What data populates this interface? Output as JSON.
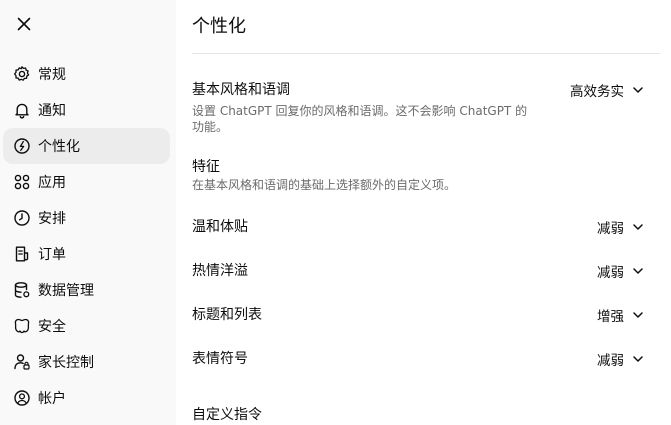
{
  "sidebar": {
    "close_icon": "close-icon",
    "items": [
      {
        "label": "常规",
        "icon": "gear-icon"
      },
      {
        "label": "通知",
        "icon": "bell-icon"
      },
      {
        "label": "个性化",
        "icon": "personalization-icon",
        "active": true
      },
      {
        "label": "应用",
        "icon": "apps-grid-icon"
      },
      {
        "label": "安排",
        "icon": "clock-icon"
      },
      {
        "label": "订单",
        "icon": "receipt-icon"
      },
      {
        "label": "数据管理",
        "icon": "database-icon"
      },
      {
        "label": "安全",
        "icon": "shield-icon"
      },
      {
        "label": "家长控制",
        "icon": "parental-control-icon"
      },
      {
        "label": "帐户",
        "icon": "account-icon"
      }
    ]
  },
  "main": {
    "title": "个性化",
    "base_style": {
      "title": "基本风格和语调",
      "description": "设置 ChatGPT 回复你的风格和语调。这不会影响 ChatGPT 的功能。",
      "value": "高效务实"
    },
    "traits": {
      "title": "特征",
      "description": "在基本风格和语调的基础上选择额外的自定义项。"
    },
    "trait_rows": [
      {
        "label": "温和体贴",
        "value": "减弱"
      },
      {
        "label": "热情洋溢",
        "value": "减弱"
      },
      {
        "label": "标题和列表",
        "value": "增强"
      },
      {
        "label": "表情符号",
        "value": "减弱"
      }
    ],
    "custom_instructions": {
      "title": "自定义指令"
    }
  }
}
